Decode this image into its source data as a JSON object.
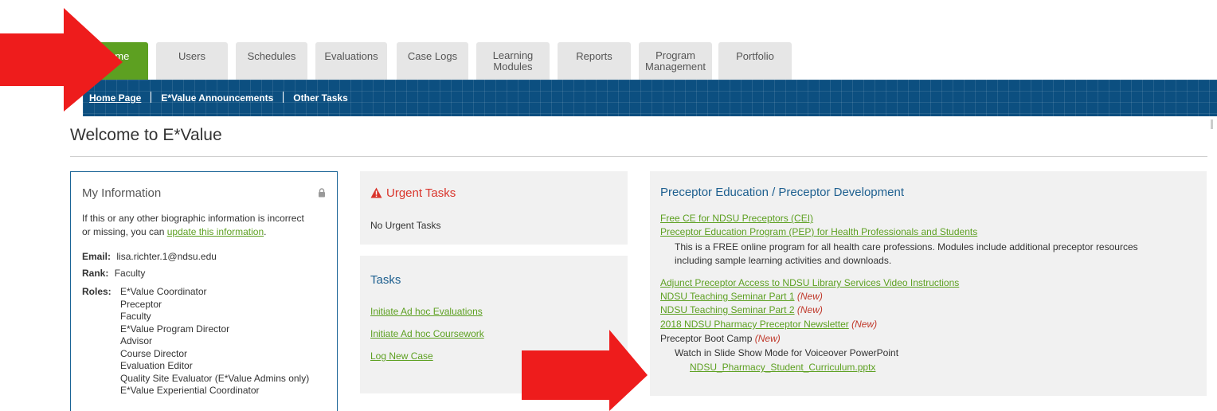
{
  "tabs": [
    {
      "label": "Home",
      "active": true
    },
    {
      "label": "Users"
    },
    {
      "label": "Schedules"
    },
    {
      "label": "Evaluations"
    },
    {
      "label": "Case Logs"
    },
    {
      "label": "Learning",
      "label2": "Modules"
    },
    {
      "label": "Reports"
    },
    {
      "label": "Program",
      "label2": "Management"
    },
    {
      "label": "Portfolio"
    }
  ],
  "subnav": {
    "items": [
      "Home Page",
      "E*Value Announcements",
      "Other Tasks"
    ]
  },
  "page": {
    "title": "Welcome to E*Value"
  },
  "my_info": {
    "title": "My Information",
    "intro_line1": "If this or any other biographic information is incorrect",
    "intro_line2_prefix": "or missing, you can ",
    "update_link": "update this information",
    "intro_line2_suffix": ".",
    "email_label": "Email:",
    "email_value": "lisa.richter.1@ndsu.edu",
    "rank_label": "Rank:",
    "rank_value": "Faculty",
    "roles_label": "Roles:",
    "roles": [
      "E*Value Coordinator",
      "Preceptor",
      "Faculty",
      "E*Value Program Director",
      "Advisor",
      "Course Director",
      "Evaluation Editor",
      "Quality Site Evaluator (E*Value Admins only)",
      "E*Value Experiential Coordinator"
    ]
  },
  "urgent": {
    "title": "Urgent Tasks",
    "empty_text": "No Urgent Tasks"
  },
  "tasks": {
    "title": "Tasks",
    "links": [
      "Initiate Ad hoc Evaluations",
      "Initiate Ad hoc Coursework",
      "Log New Case"
    ]
  },
  "preceptor": {
    "title": "Preceptor Education / Preceptor Development",
    "link_cei": "Free CE for NDSU Preceptors (CEI)",
    "link_pep": "Preceptor Education Program (PEP) for Health Professionals and Students",
    "pep_desc_line1": "This is a FREE online program for all health care professions. Modules include additional preceptor resources",
    "pep_desc_line2": "including sample learning activities and downloads.",
    "link_library": "Adjunct Preceptor Access to NDSU Library Services Video Instructions",
    "link_seminar1": "NDSU Teaching Seminar Part 1",
    "link_seminar2": "NDSU Teaching Seminar Part 2",
    "link_newsletter": "2018 NDSU Pharmacy Preceptor Newsletter",
    "bootcamp": "Preceptor Boot Camp",
    "new_tag": "(New)",
    "watch_text": "Watch in Slide Show Mode for Voiceover PowerPoint",
    "pptx_link": "NDSU_Pharmacy_Student_Curriculum.pptx"
  },
  "colors": {
    "active_tab": "#5da021",
    "subnav_bg": "#0c4f80",
    "link_green": "#5da021",
    "title_blue": "#1d5f8f",
    "alert_red": "#d9342b",
    "annotation_arrow": "#ee1c1c"
  }
}
